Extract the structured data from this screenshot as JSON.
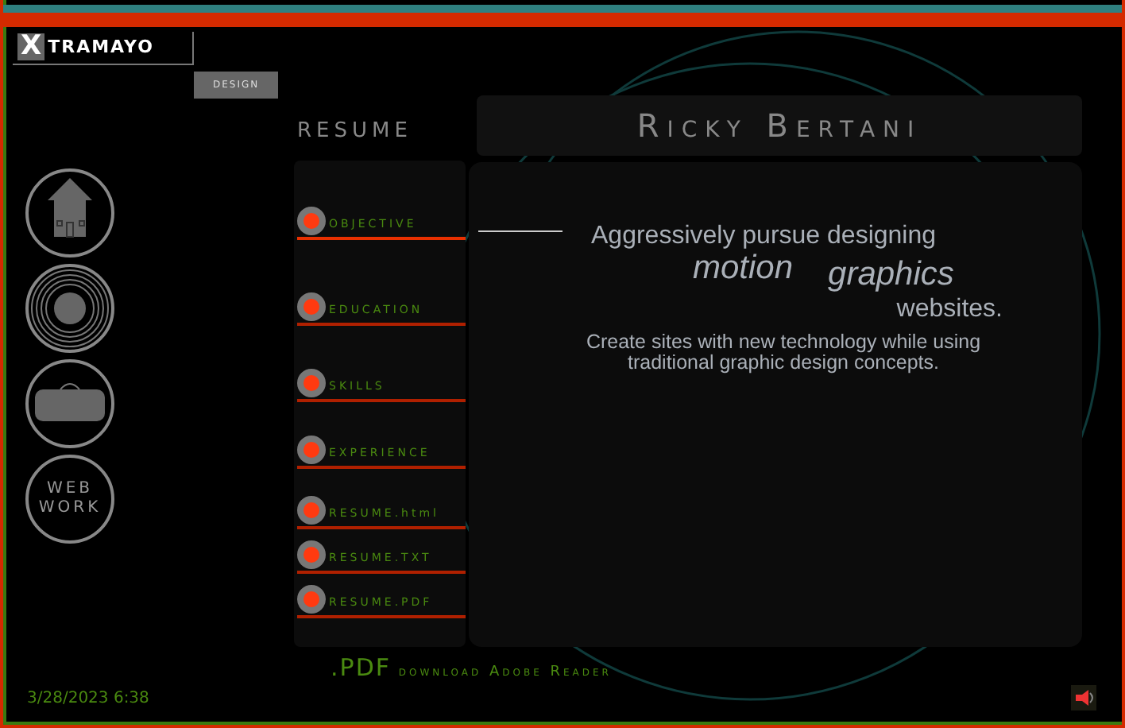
{
  "logo": {
    "mark": "X",
    "name": "TRAMAYO",
    "tag": "DESIGN"
  },
  "nav": [
    {
      "kind": "home"
    },
    {
      "kind": "disc"
    },
    {
      "kind": "bag"
    },
    {
      "kind": "text",
      "label": "WEB WORK"
    }
  ],
  "resume_heading": "RESUME",
  "name": "Ricky Bertani",
  "menu": [
    {
      "label": "OBJECTIVE",
      "selected": true
    },
    {
      "label": "EDUCATION",
      "selected": false
    },
    {
      "label": "SKILLS",
      "selected": false
    },
    {
      "label": "EXPERIENCE",
      "selected": false
    },
    {
      "label": "RESUME.html",
      "selected": false
    },
    {
      "label": "RESUME.TXT",
      "selected": false
    },
    {
      "label": "RESUME.PDF",
      "selected": false
    }
  ],
  "objective": {
    "line_1": "Aggressively pursue designing",
    "word_1": "motion",
    "word_2": "graphics",
    "line_2": "websites.",
    "note": "Create sites with new technology while using traditional graphic design concepts."
  },
  "pdf_link": {
    "ext": ".PDF",
    "text": "download Adobe Reader"
  },
  "status_bar": {
    "datetime": "3/28/2023 6:38"
  }
}
